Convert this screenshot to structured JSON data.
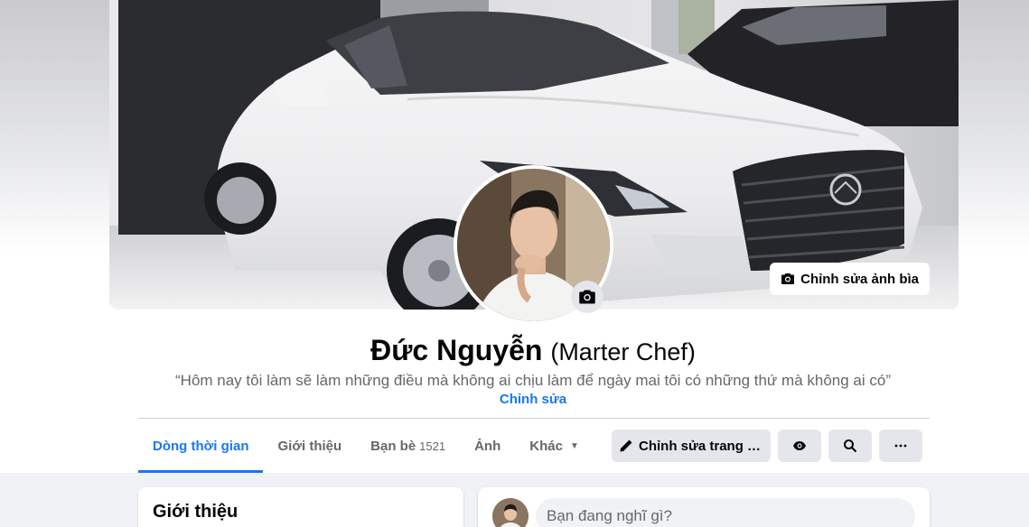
{
  "profile": {
    "name": "Đức Nguyễn",
    "alternate_name": "(Marter Chef)",
    "bio": "“Hôm nay tôi làm sẽ làm những điều mà không ai chịu làm để ngày mai tôi có những thứ mà không ai có”",
    "edit_bio_label": "Chỉnh sửa"
  },
  "cover": {
    "edit_cover_label": "Chỉnh sửa ảnh bìa",
    "camera_icon": "camera-icon"
  },
  "tabs": [
    {
      "label": "Dòng thời gian",
      "active": true
    },
    {
      "label": "Giới thiệu"
    },
    {
      "label": "Bạn bè",
      "count": "1521"
    },
    {
      "label": "Ảnh"
    },
    {
      "label": "Khác"
    }
  ],
  "actions": {
    "edit_profile_label": "Chỉnh sửa trang cá n...",
    "icons": [
      "pencil-icon",
      "eye-icon",
      "search-icon",
      "more-icon"
    ]
  },
  "intro": {
    "title": "Giới thiệu"
  },
  "composer": {
    "placeholder": "Bạn đang nghĩ gì?"
  },
  "colors": {
    "accent": "#1877f2",
    "button_bg": "#e4e6eb",
    "page_bg": "#f0f2f5",
    "secondary_text": "#65676b"
  }
}
